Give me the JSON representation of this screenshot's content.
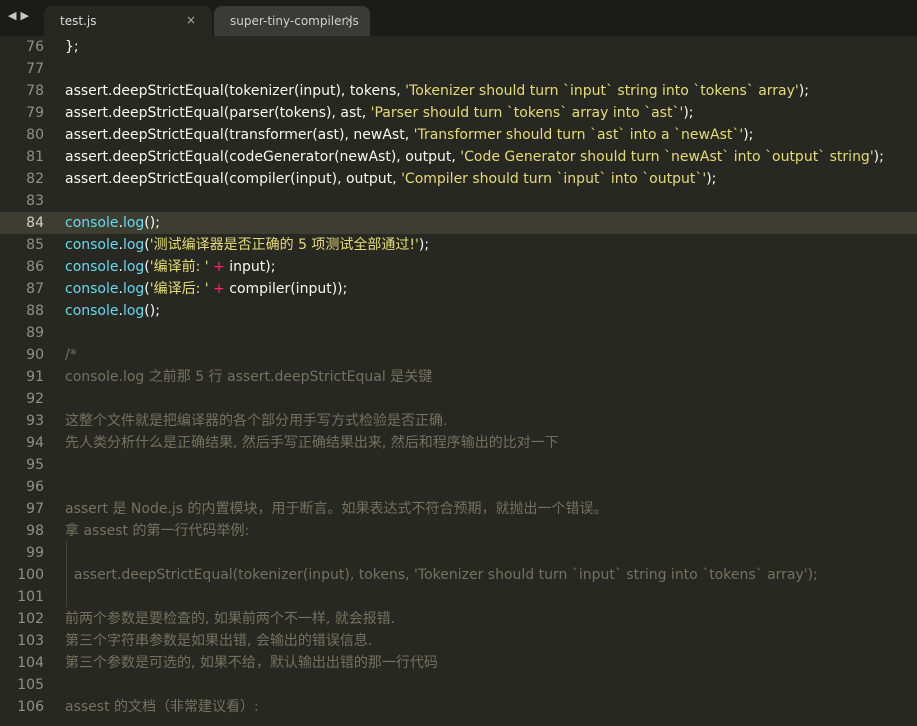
{
  "nav": {
    "back": "◀",
    "forward": "▶"
  },
  "tabs": [
    {
      "label": "test.js",
      "close": "×"
    },
    {
      "label": "super-tiny-compiler.js",
      "close": "×"
    }
  ],
  "lines": [
    {
      "n": "76",
      "segs": [
        {
          "t": "};",
          "c": ""
        }
      ]
    },
    {
      "n": "77",
      "segs": []
    },
    {
      "n": "78",
      "segs": [
        {
          "t": "assert",
          "c": ""
        },
        {
          "t": ".",
          "c": ""
        },
        {
          "t": "deepStrictEqual(tokenizer(input), tokens, ",
          "c": ""
        },
        {
          "t": "'Tokenizer should turn `input` string into `tokens` array'",
          "c": "str"
        },
        {
          "t": ");",
          "c": ""
        }
      ]
    },
    {
      "n": "79",
      "segs": [
        {
          "t": "assert.deepStrictEqual(parser(tokens), ast, ",
          "c": ""
        },
        {
          "t": "'Parser should turn `tokens` array into `ast`'",
          "c": "str"
        },
        {
          "t": ");",
          "c": ""
        }
      ]
    },
    {
      "n": "80",
      "segs": [
        {
          "t": "assert.deepStrictEqual(transformer(ast), newAst, ",
          "c": ""
        },
        {
          "t": "'Transformer should turn `ast` into a `newAst`'",
          "c": "str"
        },
        {
          "t": ");",
          "c": ""
        }
      ]
    },
    {
      "n": "81",
      "segs": [
        {
          "t": "assert.deepStrictEqual(codeGenerator(newAst), output, ",
          "c": ""
        },
        {
          "t": "'Code Generator should turn `newAst` into `output` string'",
          "c": "str"
        },
        {
          "t": ");",
          "c": ""
        }
      ]
    },
    {
      "n": "82",
      "segs": [
        {
          "t": "assert.deepStrictEqual(compiler(input), output, ",
          "c": ""
        },
        {
          "t": "'Compiler should turn `input` into `output`'",
          "c": "str"
        },
        {
          "t": ");",
          "c": ""
        }
      ]
    },
    {
      "n": "83",
      "segs": []
    },
    {
      "n": "84",
      "current": true,
      "segs": [
        {
          "t": "console",
          "c": "obj"
        },
        {
          "t": ".",
          "c": ""
        },
        {
          "t": "log",
          "c": "obj"
        },
        {
          "t": "();",
          "c": ""
        }
      ]
    },
    {
      "n": "85",
      "segs": [
        {
          "t": "console",
          "c": "obj"
        },
        {
          "t": ".",
          "c": ""
        },
        {
          "t": "log",
          "c": "obj"
        },
        {
          "t": "(",
          "c": ""
        },
        {
          "t": "'测试编译器是否正确的 5 项测试全部通过!'",
          "c": "str"
        },
        {
          "t": ");",
          "c": ""
        }
      ]
    },
    {
      "n": "86",
      "segs": [
        {
          "t": "console",
          "c": "obj"
        },
        {
          "t": ".",
          "c": ""
        },
        {
          "t": "log",
          "c": "obj"
        },
        {
          "t": "(",
          "c": ""
        },
        {
          "t": "'编译前: '",
          "c": "str"
        },
        {
          "t": " + ",
          "c": "op"
        },
        {
          "t": "input);",
          "c": ""
        }
      ]
    },
    {
      "n": "87",
      "segs": [
        {
          "t": "console",
          "c": "obj"
        },
        {
          "t": ".",
          "c": ""
        },
        {
          "t": "log",
          "c": "obj"
        },
        {
          "t": "(",
          "c": ""
        },
        {
          "t": "'编译后: '",
          "c": "str"
        },
        {
          "t": " + ",
          "c": "op"
        },
        {
          "t": "compiler(input));",
          "c": ""
        }
      ]
    },
    {
      "n": "88",
      "segs": [
        {
          "t": "console",
          "c": "obj"
        },
        {
          "t": ".",
          "c": ""
        },
        {
          "t": "log",
          "c": "obj"
        },
        {
          "t": "();",
          "c": ""
        }
      ]
    },
    {
      "n": "89",
      "segs": []
    },
    {
      "n": "90",
      "segs": [
        {
          "t": "/*",
          "c": "comment"
        }
      ]
    },
    {
      "n": "91",
      "segs": [
        {
          "t": "console.log 之前那 5 行 assert.deepStrictEqual 是关键",
          "c": "comment"
        }
      ]
    },
    {
      "n": "92",
      "segs": []
    },
    {
      "n": "93",
      "segs": [
        {
          "t": "这整个文件就是把编译器的各个部分用手写方式检验是否正确.",
          "c": "comment"
        }
      ]
    },
    {
      "n": "94",
      "segs": [
        {
          "t": "先人类分析什么是正确结果, 然后手写正确结果出来, 然后和程序输出的比对一下",
          "c": "comment"
        }
      ]
    },
    {
      "n": "95",
      "segs": []
    },
    {
      "n": "96",
      "segs": []
    },
    {
      "n": "97",
      "segs": [
        {
          "t": "assert 是 Node.js 的内置模块，用于断言。如果表达式不符合预期，就抛出一个错误。",
          "c": "comment"
        }
      ]
    },
    {
      "n": "98",
      "segs": [
        {
          "t": "拿 assest 的第一行代码举例:",
          "c": "comment"
        }
      ]
    },
    {
      "n": "99",
      "segs": []
    },
    {
      "n": "100",
      "segs": [
        {
          "t": "  assert.deepStrictEqual(tokenizer(input), tokens, 'Tokenizer should turn `input` string into `tokens` array');",
          "c": "comment"
        }
      ]
    },
    {
      "n": "101",
      "segs": []
    },
    {
      "n": "102",
      "segs": [
        {
          "t": "前两个参数是要检查的, 如果前两个不一样, 就会报错.",
          "c": "comment"
        }
      ]
    },
    {
      "n": "103",
      "segs": [
        {
          "t": "第三个字符串参数是如果出错, 会输出的错误信息.",
          "c": "comment"
        }
      ]
    },
    {
      "n": "104",
      "segs": [
        {
          "t": "第三个参数是可选的, 如果不给，默认输出出错的那一行代码",
          "c": "comment"
        }
      ]
    },
    {
      "n": "105",
      "segs": []
    },
    {
      "n": "106",
      "segs": [
        {
          "t": "assest 的文档（非常建议看）:",
          "c": "comment"
        }
      ]
    }
  ]
}
